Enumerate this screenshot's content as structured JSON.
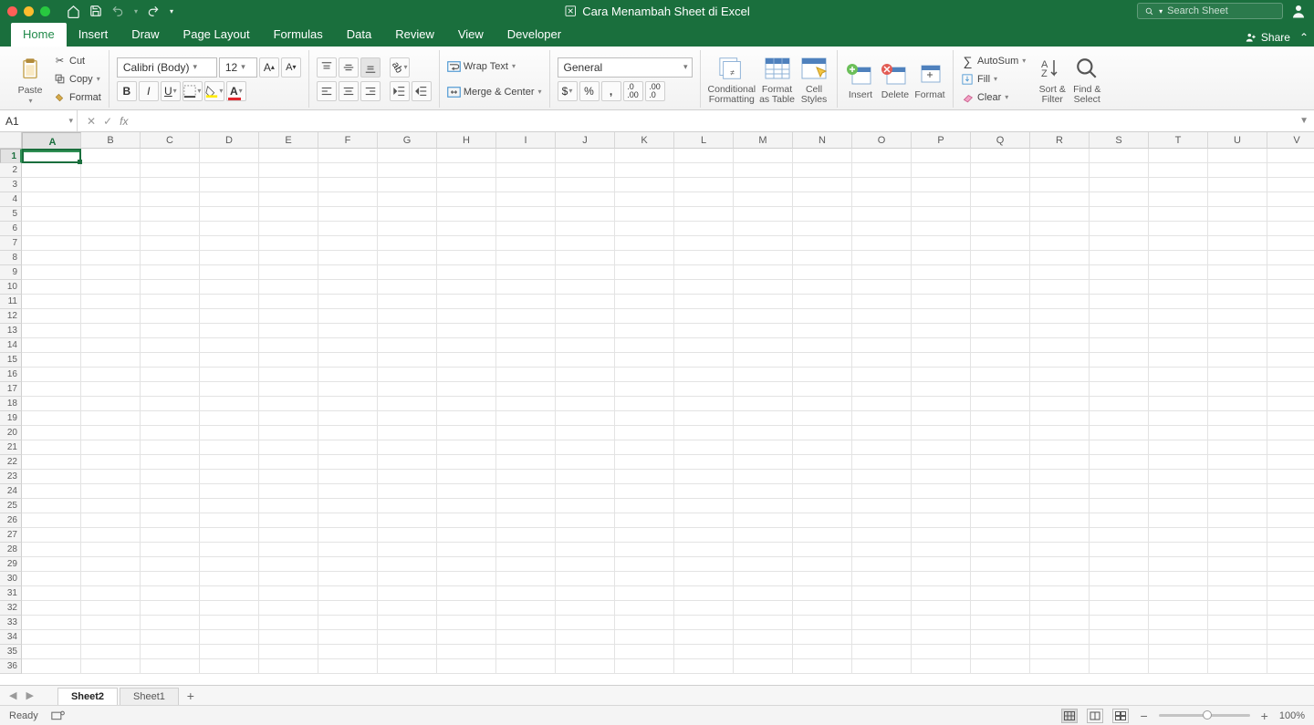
{
  "window": {
    "title": "Cara Menambah Sheet di Excel"
  },
  "search": {
    "placeholder": "Search Sheet"
  },
  "tabs": {
    "items": [
      "Home",
      "Insert",
      "Draw",
      "Page Layout",
      "Formulas",
      "Data",
      "Review",
      "View",
      "Developer"
    ],
    "active": 0,
    "share": "Share"
  },
  "ribbon": {
    "paste": "Paste",
    "cut": "Cut",
    "copy": "Copy",
    "format_painter": "Format",
    "font_name": "Calibri (Body)",
    "font_size": "12",
    "wrap": "Wrap Text",
    "merge": "Merge & Center",
    "num_format": "General",
    "cond": "Conditional",
    "cond2": "Formatting",
    "fmt_tbl": "Format",
    "fmt_tbl2": "as Table",
    "cell_sty": "Cell",
    "cell_sty2": "Styles",
    "insert": "Insert",
    "delete": "Delete",
    "format": "Format",
    "autosum": "AutoSum",
    "fill": "Fill",
    "clear": "Clear",
    "sort": "Sort &",
    "sort2": "Filter",
    "find": "Find &",
    "find2": "Select"
  },
  "formula_bar": {
    "cell_ref": "A1",
    "value": ""
  },
  "grid": {
    "cols": [
      "A",
      "B",
      "C",
      "D",
      "E",
      "F",
      "G",
      "H",
      "I",
      "J",
      "K",
      "L",
      "M",
      "N",
      "O",
      "P",
      "Q",
      "R",
      "S",
      "T",
      "U",
      "V"
    ],
    "rows": 36,
    "active": "A1"
  },
  "sheets": {
    "tabs": [
      "Sheet2",
      "Sheet1"
    ],
    "active": 0
  },
  "status": {
    "ready": "Ready",
    "zoom": "100%"
  }
}
